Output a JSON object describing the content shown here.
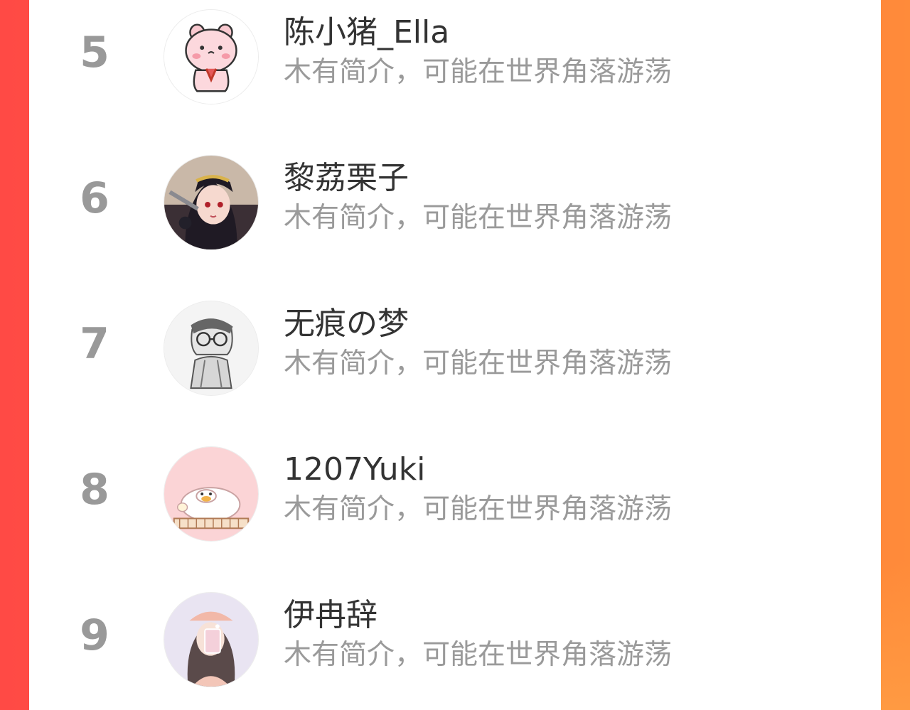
{
  "colors": {
    "background_left": "#ff4a45",
    "background_right": "#ff8b3a",
    "panel": "#ffffff",
    "rank_text": "#999999",
    "name_text": "#333333",
    "bio_text": "#9a9a9a"
  },
  "ranking": {
    "items": [
      {
        "rank": "5",
        "name": "陈小猪_Ella",
        "bio": "木有简介，可能在世界角落游荡",
        "avatar_icon": "pink-pig-avatar-icon"
      },
      {
        "rank": "6",
        "name": "黎荔栗子",
        "bio": "木有简介，可能在世界角落游荡",
        "avatar_icon": "anime-girl-avatar-icon"
      },
      {
        "rank": "7",
        "name": "无痕の梦",
        "bio": "木有简介，可能在世界角落游荡",
        "avatar_icon": "sketch-boy-avatar-icon"
      },
      {
        "rank": "8",
        "name": "1207Yuki",
        "bio": "木有简介，可能在世界角落游荡",
        "avatar_icon": "duck-avatar-icon"
      },
      {
        "rank": "9",
        "name": "伊冉辞",
        "bio": "木有简介，可能在世界角落游荡",
        "avatar_icon": "selfie-girl-avatar-icon"
      }
    ]
  }
}
